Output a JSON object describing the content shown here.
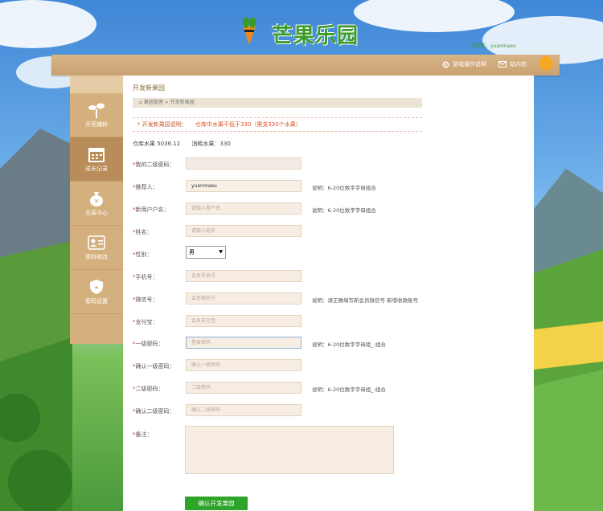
{
  "brand": {
    "logo_text": "芒果乐园",
    "welcome": "欢迎您，yuanmaeu"
  },
  "topbar": {
    "help_label": "游戏操作说明",
    "mail_label": "站内信"
  },
  "sidebar": {
    "items": [
      {
        "label": "开荒播种",
        "icon": "sprout-icon"
      },
      {
        "label": "成长记录",
        "icon": "calendar-icon"
      },
      {
        "label": "交易中心",
        "icon": "money-bag-icon"
      },
      {
        "label": "资料修改",
        "icon": "id-card-icon"
      },
      {
        "label": "密码设置",
        "icon": "shield-icon"
      }
    ]
  },
  "page": {
    "title": "开发新果园",
    "breadcrumb": {
      "home": "果园管理",
      "current": "开发新果园"
    },
    "notice_label": "* 开发新果园说明：",
    "notice_text": "仓库中水果不低于330（需支330个水果）",
    "stock_label": "仓库水果 5036.12",
    "cost_label": "消耗水果：330"
  },
  "form": {
    "fields": [
      {
        "label": "我的二级密码：",
        "value": "",
        "placeholder": "",
        "hint": ""
      },
      {
        "label": "推荐人：",
        "value": "yuanmaeu",
        "placeholder": "",
        "hint": "说明：6-20位数字字母组合"
      },
      {
        "label": "新用户户名：",
        "value": "",
        "placeholder": "请输入用户名",
        "hint": "说明：6-20位数字字母组合"
      },
      {
        "label": "姓名：",
        "value": "",
        "placeholder": "请输入姓名",
        "hint": ""
      },
      {
        "label": "性别：",
        "value": "男",
        "placeholder": "",
        "hint": ""
      },
      {
        "label": "手机号：",
        "value": "",
        "placeholder": "会员手机号",
        "hint": ""
      },
      {
        "label": "微信号：",
        "value": "",
        "placeholder": "会员微信号",
        "hint": "说明：请正确填写新会员微信号 新增收款账号"
      },
      {
        "label": "支付宝：",
        "value": "",
        "placeholder": "会员支付宝",
        "hint": ""
      },
      {
        "label": "一级密码：",
        "value": "",
        "placeholder": "登录密码",
        "hint": "说明：6-20位数字字母组_-组合"
      },
      {
        "label": "确认一级密码：",
        "value": "",
        "placeholder": "确认一级密码",
        "hint": ""
      },
      {
        "label": "二级密码：",
        "value": "",
        "placeholder": "二级密码",
        "hint": "说明：6-20位数字字母组_-组合"
      },
      {
        "label": "确认二级密码：",
        "value": "",
        "placeholder": "确认二级密码",
        "hint": ""
      }
    ],
    "remark_label": "备注：",
    "submit_label": "确认开发果园"
  },
  "colors": {
    "accent": "#2fa42a",
    "sidebar": "#d5b07f",
    "topbar": "#cda578"
  }
}
